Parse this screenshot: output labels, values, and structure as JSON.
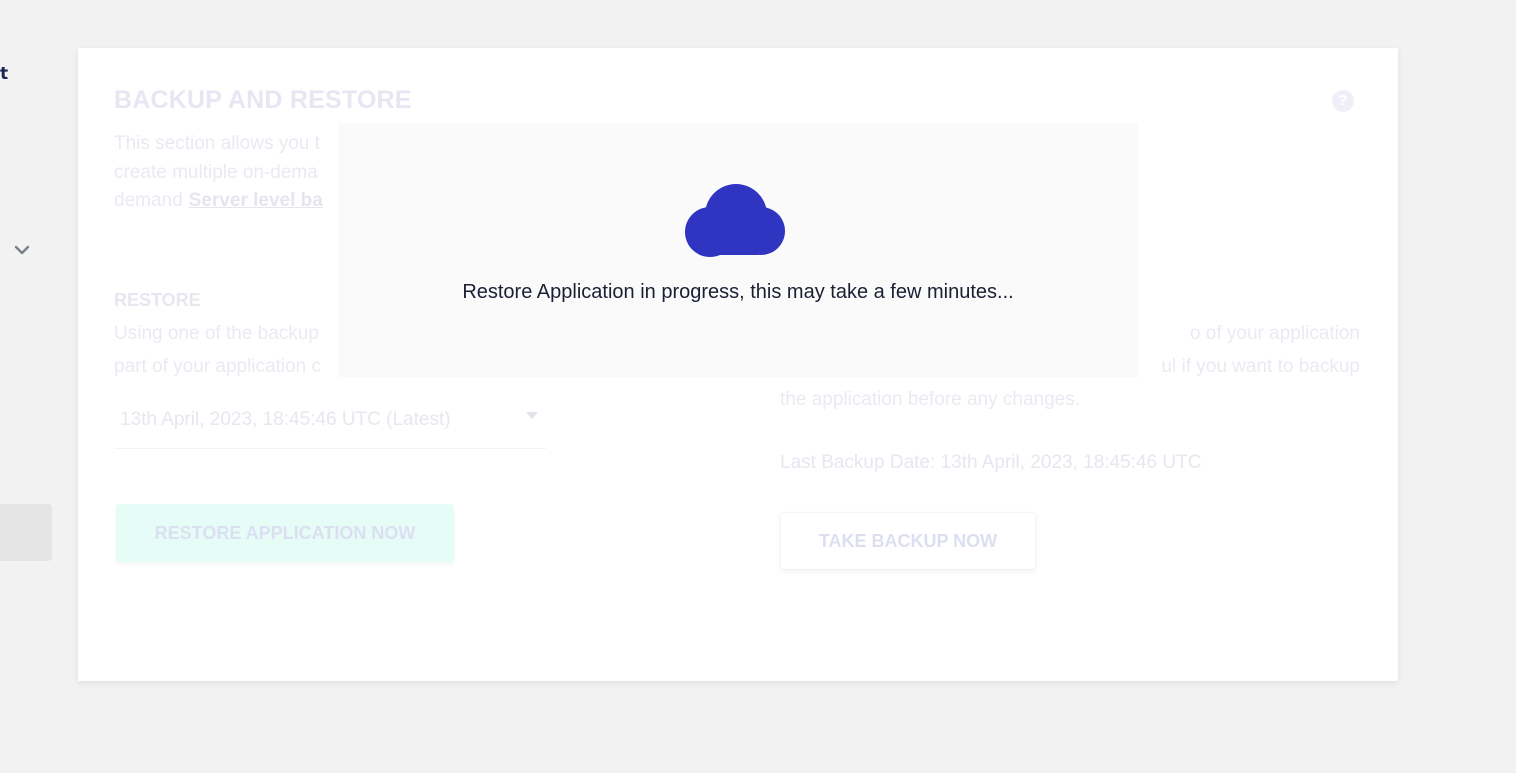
{
  "sidebar": {
    "fragment_text": "t"
  },
  "card": {
    "title": "BACKUP AND RESTORE",
    "help_icon": "?",
    "intro_lines": [
      "This section allows you t",
      "create multiple on-dema",
      "demand"
    ],
    "intro_link": "Server level ba",
    "restore": {
      "heading": "RESTORE",
      "desc_lines": [
        "Using one of the backup",
        "part of your application c"
      ],
      "select_value": "13th April, 2023, 18:45:46 UTC (Latest)",
      "button_label": "RESTORE APPLICATION NOW"
    },
    "backup": {
      "desc_lines": [
        "o of your application",
        "ul if you want to backup",
        "the application before any changes."
      ],
      "last_backup": "Last Backup Date: 13th April, 2023, 18:45:46 UTC",
      "button_label": "TAKE BACKUP NOW"
    }
  },
  "overlay": {
    "icon": "cloud-icon",
    "message": "Restore Application in progress, this may take a few minutes..."
  },
  "colors": {
    "cloud": "#2f35c0",
    "background": "#f2f2f2",
    "overlay": "#fafafa"
  }
}
